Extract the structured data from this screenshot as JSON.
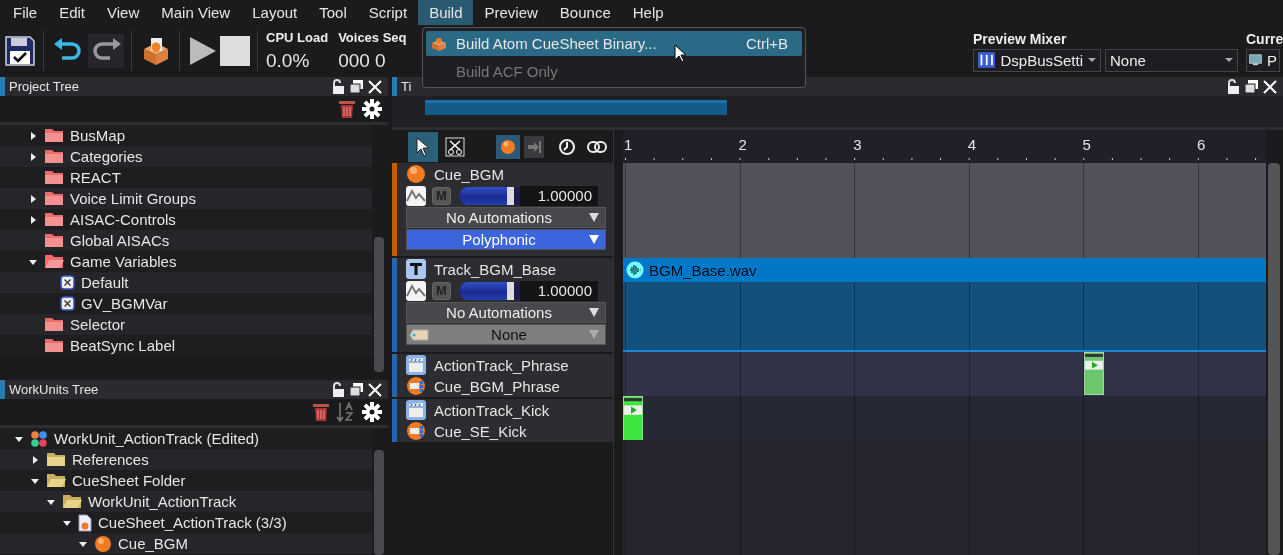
{
  "menu_bar": [
    {
      "label": "File",
      "selected": false
    },
    {
      "label": "Edit",
      "selected": false
    },
    {
      "label": "View",
      "selected": false
    },
    {
      "label": "Main View",
      "selected": false
    },
    {
      "label": "Layout",
      "selected": false
    },
    {
      "label": "Tool",
      "selected": false
    },
    {
      "label": "Script",
      "selected": false
    },
    {
      "label": "Build",
      "selected": true
    },
    {
      "label": "Preview",
      "selected": false
    },
    {
      "label": "Bounce",
      "selected": false
    },
    {
      "label": "Help",
      "selected": false
    }
  ],
  "toolbar": {
    "stats": [
      {
        "label": "CPU Load",
        "value": "0.0%"
      },
      {
        "label": "Voices Seq",
        "value": "000 0"
      }
    ],
    "preview_mixer": {
      "label": "Preview Mixer",
      "mixer": "DspBusSetti",
      "target": "None"
    },
    "current": {
      "label": "Curre",
      "value": "P"
    }
  },
  "build_menu": [
    {
      "label": "Build Atom CueSheet Binary...",
      "shortcut": "Ctrl+B",
      "selected": true,
      "disabled": false
    },
    {
      "label": "Build ACF Only",
      "selected": false,
      "disabled": true
    }
  ],
  "project_tree": {
    "title": "Project Tree",
    "items": [
      {
        "label": "BusMap",
        "kind": "group",
        "expanded": false
      },
      {
        "label": "Categories",
        "kind": "group",
        "expanded": false
      },
      {
        "label": "REACT",
        "kind": "group"
      },
      {
        "label": "Voice Limit Groups",
        "kind": "group",
        "expanded": false
      },
      {
        "label": "AISAC-Controls",
        "kind": "group",
        "expanded": false
      },
      {
        "label": "Global AISACs",
        "kind": "group"
      },
      {
        "label": "Game Variables",
        "kind": "group",
        "expanded": true,
        "children": [
          {
            "label": "Default",
            "kind": "variable"
          },
          {
            "label": "GV_BGMVar",
            "kind": "variable"
          }
        ]
      },
      {
        "label": "Selector",
        "kind": "group"
      },
      {
        "label": "BeatSync Label",
        "kind": "group"
      }
    ]
  },
  "workunits_tree": {
    "title": "WorkUnits Tree",
    "items": [
      {
        "label": "WorkUnit_ActionTrack (Edited)",
        "kind": "workunit",
        "expanded": true,
        "children": [
          {
            "label": "References",
            "kind": "folder",
            "expanded": false
          },
          {
            "label": "CueSheet Folder",
            "kind": "folder",
            "expanded": true,
            "children": [
              {
                "label": "WorkUnit_ActionTrack",
                "kind": "folder",
                "expanded": true,
                "children": [
                  {
                    "label": "CueSheet_ActionTrack (3/3)",
                    "kind": "cuesheet",
                    "expanded": true,
                    "children": [
                      {
                        "label": "Cue_BGM",
                        "kind": "cue",
                        "expanded": true
                      }
                    ]
                  }
                ]
              }
            ]
          }
        ]
      }
    ]
  },
  "timeline": {
    "title": "Ti",
    "tools": [
      {
        "kind": "select",
        "selected": true
      },
      {
        "kind": "cut",
        "selected": false
      },
      {
        "kind": "cue",
        "selected": true
      },
      {
        "kind": "snap",
        "selected": false
      },
      {
        "kind": "clock",
        "selected": false
      },
      {
        "kind": "link",
        "selected": false
      }
    ],
    "ruler": [
      "1",
      "2",
      "3",
      "4",
      "5",
      "6"
    ],
    "tracks": [
      {
        "kind": "cue",
        "name": "Cue_BGM",
        "mute": "M",
        "volume": {
          "level": 0.9,
          "reading": "1.00000"
        },
        "automation": "No Automations",
        "mode": "Polyphonic"
      },
      {
        "kind": "track",
        "name": "Track_BGM_Base",
        "mute": "M",
        "volume": {
          "level": 0.9,
          "reading": "1.00000"
        },
        "automation": "No Automations",
        "tag": "None",
        "clip": "BGM_Base.wav"
      },
      {
        "kind": "action",
        "name": "ActionTrack_Phrase",
        "cue": "Cue_BGM_Phrase"
      },
      {
        "kind": "action",
        "name": "ActionTrack_Kick",
        "cue": "Cue_SE_Kick"
      }
    ]
  }
}
